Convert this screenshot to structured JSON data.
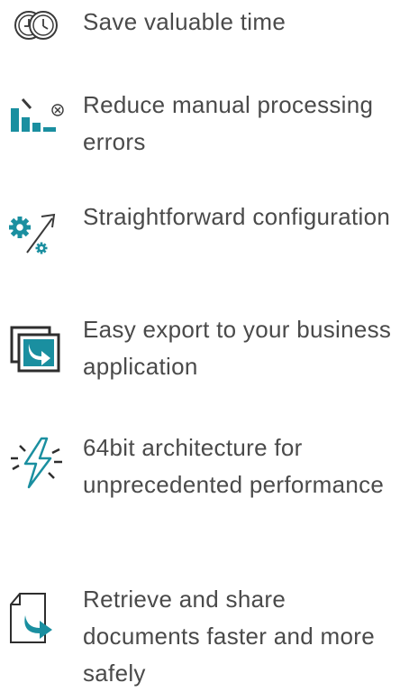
{
  "features": [
    {
      "text": "Save valuable time",
      "icon": "clocks-icon"
    },
    {
      "text": "Reduce manual processing errors",
      "icon": "reduce-errors-icon"
    },
    {
      "text": "Straightforward configuration",
      "icon": "configuration-gears-icon"
    },
    {
      "text": "Easy export to your business application",
      "icon": "export-icon"
    },
    {
      "text": "64bit architecture for unprecedented performance",
      "icon": "lightning-icon"
    },
    {
      "text": "Retrieve and share documents faster and more safely",
      "icon": "document-share-icon"
    }
  ],
  "colors": {
    "text": "#4a4a4a",
    "accent": "#1a8fa0",
    "dark": "#2e2e2e",
    "line": "#3a3a3a"
  }
}
